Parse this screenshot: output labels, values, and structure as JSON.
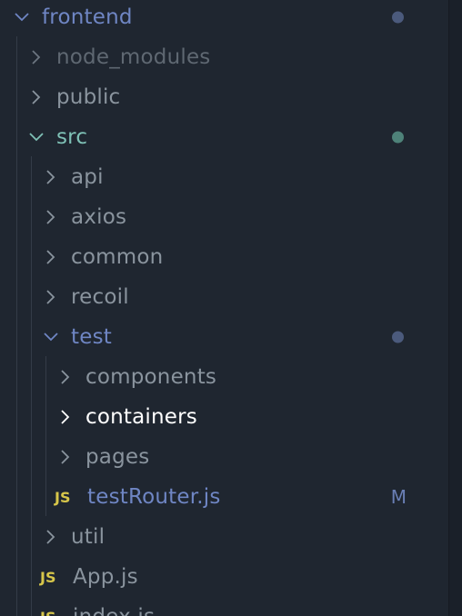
{
  "explorer": {
    "colors": {
      "default_text": "#8a949e",
      "dim_text": "#6c7580",
      "modified_text": "#6f86c4",
      "untracked_text": "#7fc1b6",
      "selected_text": "#ffffff",
      "modified_dot": "#4b5a7c",
      "untracked_dot": "#4e8279"
    },
    "items": [
      {
        "label": "frontend",
        "type": "folder",
        "expanded": true,
        "chevron_icon": "chevron-down-icon",
        "status": "modified-dot"
      },
      {
        "label": "node_modules",
        "type": "folder",
        "expanded": false,
        "chevron_icon": "chevron-right-icon",
        "status": "ignored"
      },
      {
        "label": "public",
        "type": "folder",
        "expanded": false,
        "chevron_icon": "chevron-right-icon"
      },
      {
        "label": "src",
        "type": "folder",
        "expanded": true,
        "chevron_icon": "chevron-down-icon",
        "status": "untracked-dot"
      },
      {
        "label": "api",
        "type": "folder",
        "expanded": false,
        "chevron_icon": "chevron-right-icon"
      },
      {
        "label": "axios",
        "type": "folder",
        "expanded": false,
        "chevron_icon": "chevron-right-icon"
      },
      {
        "label": "common",
        "type": "folder",
        "expanded": false,
        "chevron_icon": "chevron-right-icon"
      },
      {
        "label": "recoil",
        "type": "folder",
        "expanded": false,
        "chevron_icon": "chevron-right-icon"
      },
      {
        "label": "test",
        "type": "folder",
        "expanded": true,
        "chevron_icon": "chevron-down-icon",
        "status": "modified-dot"
      },
      {
        "label": "components",
        "type": "folder",
        "expanded": false,
        "chevron_icon": "chevron-right-icon"
      },
      {
        "label": "containers",
        "type": "folder",
        "expanded": false,
        "chevron_icon": "chevron-right-icon",
        "selected": true
      },
      {
        "label": "pages",
        "type": "folder",
        "expanded": false,
        "chevron_icon": "chevron-right-icon"
      },
      {
        "label": "testRouter.js",
        "type": "file",
        "badge": "JS",
        "status": "M"
      },
      {
        "label": "util",
        "type": "folder",
        "expanded": false,
        "chevron_icon": "chevron-right-icon"
      },
      {
        "label": "App.js",
        "type": "file",
        "badge": "JS"
      },
      {
        "label": "index.js",
        "type": "file",
        "badge": "JS"
      }
    ]
  }
}
